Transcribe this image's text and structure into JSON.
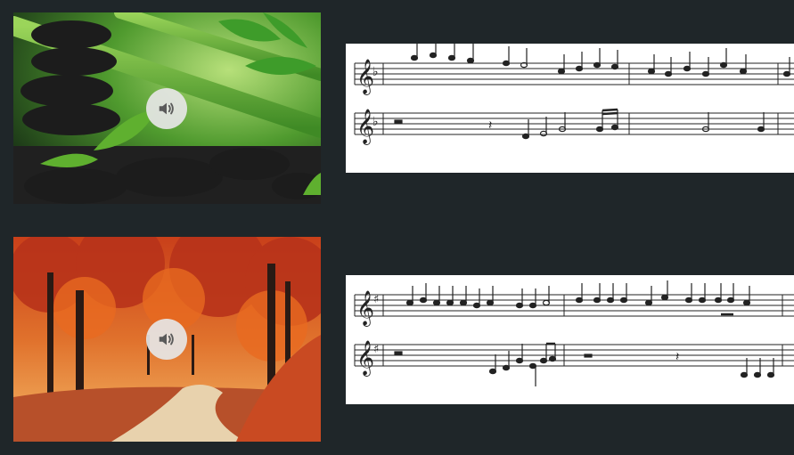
{
  "gallery": [
    {
      "thumbnail": "zen-stones-bamboo",
      "audio_icon": "speaker-icon",
      "score": {
        "key_signature": "one-flat",
        "staves": 2
      }
    },
    {
      "thumbnail": "autumn-forest-path",
      "audio_icon": "speaker-icon",
      "score": {
        "key_signature": "one-sharp",
        "staves": 2
      }
    }
  ],
  "colors": {
    "background": "#1f2629",
    "play_button": "#e6e6e6",
    "icon": "#5a5a5a",
    "sheet": "#ffffff"
  }
}
